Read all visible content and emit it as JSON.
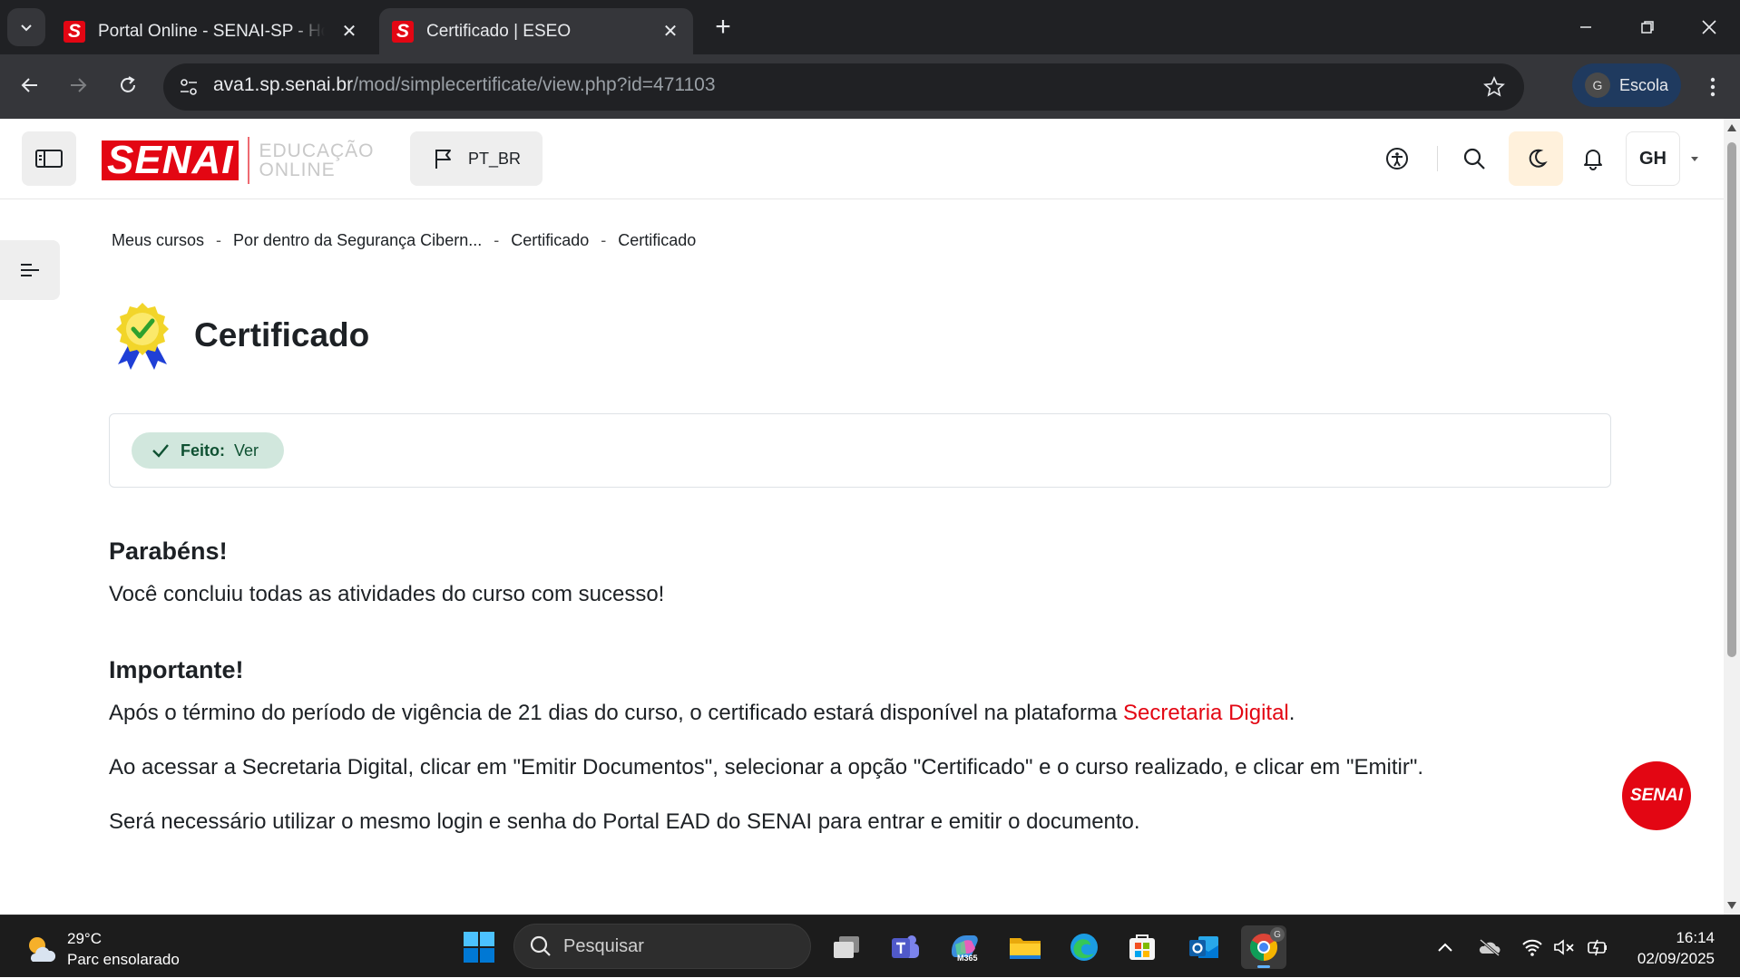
{
  "browser": {
    "tabs": [
      {
        "title": "Portal Online - SENAI-SP - Home",
        "favicon": "S",
        "active": false
      },
      {
        "title": "Certificado | ESEO",
        "favicon": "S",
        "active": true
      }
    ],
    "address": {
      "host": "ava1.sp.senai.br",
      "path": "/mod/simplecertificate/view.php?id=471103"
    },
    "profile": {
      "initial": "G",
      "name": "Escola"
    }
  },
  "site": {
    "logo_brand": "SENAI",
    "logo_line1": "EDUCAÇÃO",
    "logo_line2": "ONLINE",
    "language": "PT_BR",
    "user_initials": "GH",
    "fab_label": "SENAI"
  },
  "breadcrumb": [
    "Meus cursos",
    "Por dentro da Segurança Cibern...",
    "Certificado",
    "Certificado"
  ],
  "page_title": "Certificado",
  "completion": {
    "label": "Feito:",
    "value": "Ver"
  },
  "content": {
    "heading1": "Parabéns!",
    "text1": "Você concluiu todas as atividades do curso com sucesso!",
    "heading2": "Importante!",
    "p1_before": "Após o término do período de vigência de 21 dias do curso, o certificado estará disponível na plataforma ",
    "p1_link": "Secretaria Digital",
    "p1_after": ".",
    "p2": "Ao acessar a Secretaria Digital, clicar em \"Emitir Documentos\", selecionar a opção \"Certificado\" e o curso realizado, e clicar em \"Emitir\".",
    "p3": "Será necessário utilizar o mesmo login e senha do Portal EAD do SENAI para entrar e emitir o documento."
  },
  "taskbar": {
    "weather_temp": "29°C",
    "weather_desc": "Parc ensolarado",
    "search_placeholder": "Pesquisar",
    "m365_label": "M365",
    "time": "16:14",
    "date": "02/09/2025"
  },
  "colors": {
    "brand": "#e30613",
    "success_bg": "#d1e7dd",
    "success_text": "#0f5132"
  }
}
